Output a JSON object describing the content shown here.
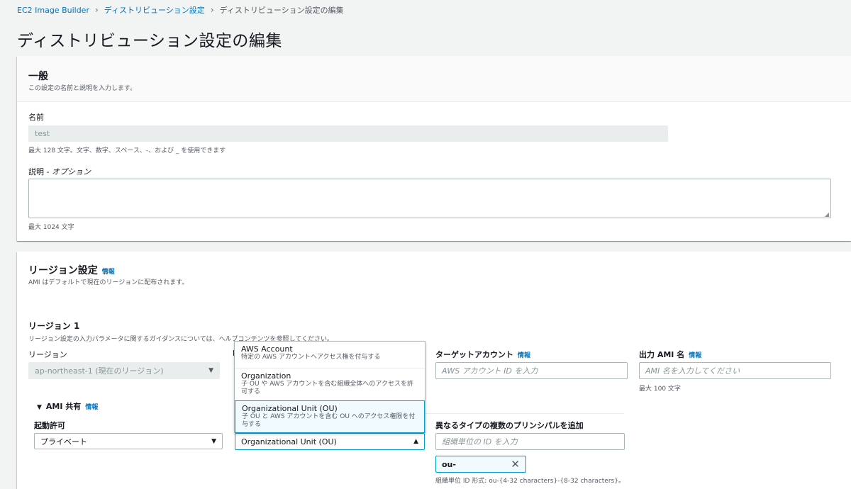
{
  "breadcrumb": {
    "root": "EC2 Image Builder",
    "parent": "ディストリビューション設定",
    "current": "ディストリビューション設定の編集"
  },
  "page_title": "ディストリビューション設定の編集",
  "general": {
    "title": "一般",
    "description": "この設定の名前と説明を入力します。",
    "name_label": "名前",
    "name_value": "test",
    "name_hint": "最大 128 文字。文字、数字、スペース、-、および _ を使用できます",
    "desc_label_main": "説明 - ",
    "desc_label_optional": "オプション",
    "desc_hint": "最大 1024 文字"
  },
  "region_settings": {
    "title": "リージョン設定",
    "info": "情報",
    "description": "AMI はデフォルトで現在のリージョンに配布されます。",
    "region1_title": "リージョン 1",
    "region1_desc": "リージョン設定の入力パラメータに関するガイダンスについては、ヘルプコンテンツを参照してください。",
    "region_label": "リージョン",
    "region_value": "ap-northeast-1 (現在のリージョン)",
    "target_account_label": "ターゲットアカウント",
    "target_account_info": "情報",
    "target_account_placeholder": "AWS アカウント ID を入力",
    "output_ami_label": "出力 AMI 名",
    "output_ami_info": "情報",
    "output_ami_placeholder": "AMI 名を入力してください",
    "output_ami_hint": "最大 100 文字",
    "ami_sharing_title": "AMI 共有",
    "ami_sharing_info": "情報",
    "launch_permission_label": "起動許可",
    "launch_permission_value": "プライベート",
    "principal_type_value": "Organizational Unit (OU)",
    "multi_principal_label": "異なるタイプの複数のプリンシパルを追加",
    "ou_placeholder": "組織単位の ID を入力",
    "ou_token": "ou-",
    "ou_hint": "組織単位 ID 形式: ou-{4-32 characters}-{8-32 characters}。"
  },
  "dropdown_options": [
    {
      "title": "AWS Account",
      "desc": "特定の AWS アカウントへアクセス権を付与する"
    },
    {
      "title": "Organization",
      "desc": "子 OU や AWS アカウントを含む組織全体へのアクセスを許可する"
    },
    {
      "title": "Organizational Unit (OU)",
      "desc": "子 OU と AWS アカウントを含む OU へのアクセス権限を付与する"
    }
  ]
}
